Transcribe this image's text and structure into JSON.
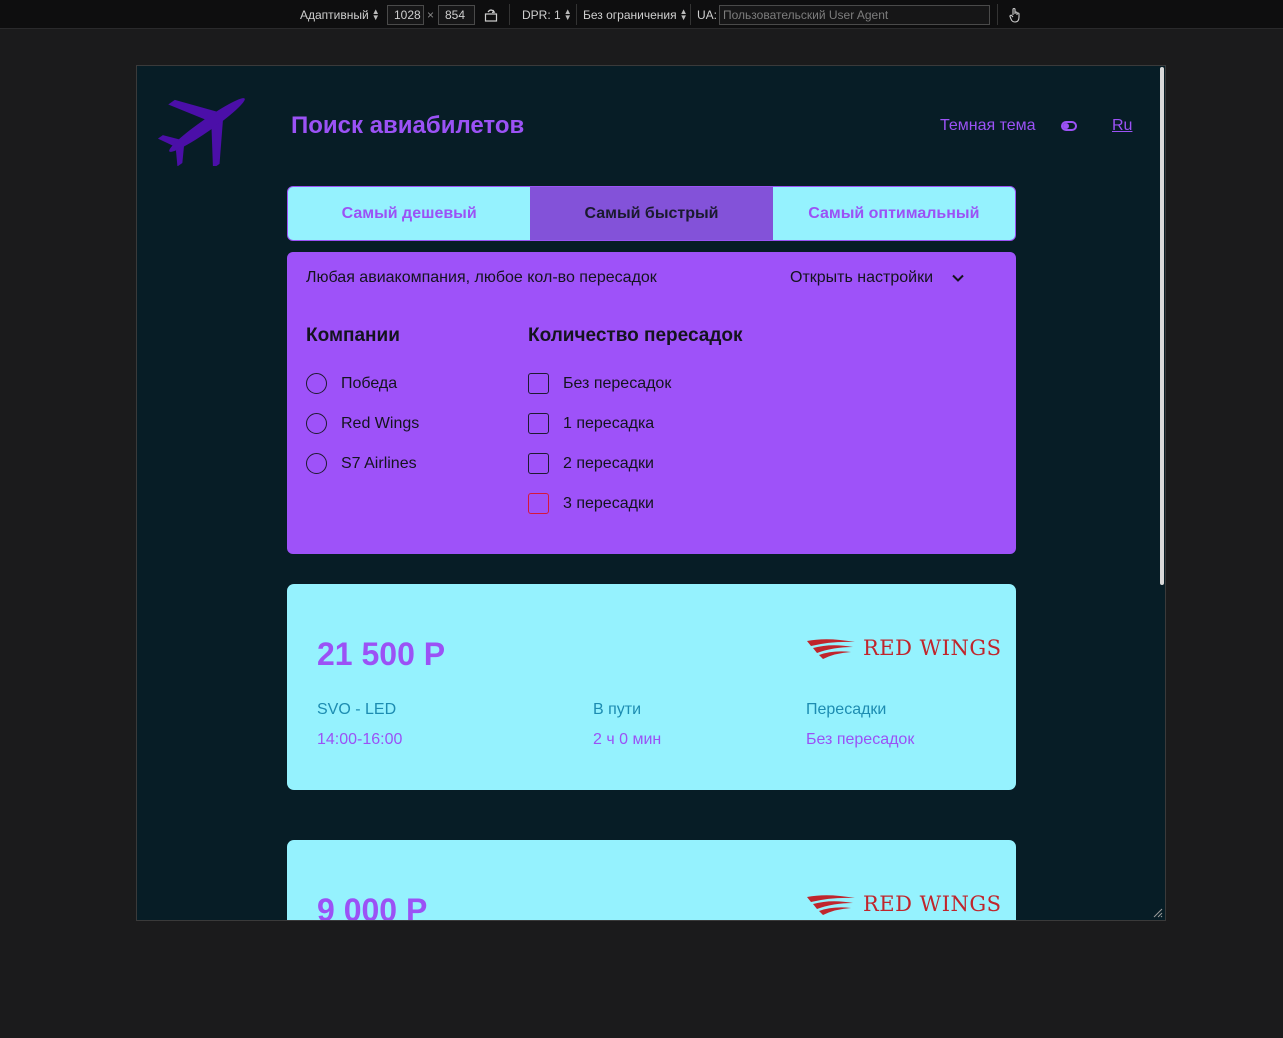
{
  "devtools": {
    "device_mode": "Адаптивный",
    "width": "1028",
    "times": "×",
    "height": "854",
    "dpr": "DPR: 1",
    "throttle": "Без ограничения",
    "ua_label": "UA:",
    "ua_placeholder": "Пользовательский User Agent"
  },
  "header": {
    "title": "Поиск авиабилетов",
    "theme_label": "Темная тема",
    "lang": "Ru"
  },
  "tabs": [
    {
      "label": "Самый дешевый",
      "active": false
    },
    {
      "label": "Самый быстрый",
      "active": true
    },
    {
      "label": "Самый оптимальный",
      "active": false
    }
  ],
  "filters": {
    "summary": "Любая авиакомпания, любое кол-во пересадок",
    "open_settings": "Открыть настройки",
    "companies_title": "Компании",
    "companies": [
      "Победа",
      "Red Wings",
      "S7 Airlines"
    ],
    "transfers_title": "Количество пересадок",
    "transfers": [
      "Без пересадок",
      "1 пересадка",
      "2 пересадки",
      "3 пересадки"
    ]
  },
  "tickets": [
    {
      "price": "21 500 Р",
      "airline": "RED WINGS",
      "route_head": "SVO - LED",
      "route_val": "14:00-16:00",
      "duration_head": "В пути",
      "duration_val": "2 ч 0 мин",
      "transfers_head": "Пересадки",
      "transfers_val": "Без пересадок"
    },
    {
      "price": "9 000 Р",
      "airline": "RED WINGS"
    }
  ],
  "colors": {
    "accent": "#9b52f5",
    "panel": "#9e52f9",
    "card": "#95f2fe",
    "background": "#071d26",
    "brand_red": "#c0252c"
  }
}
